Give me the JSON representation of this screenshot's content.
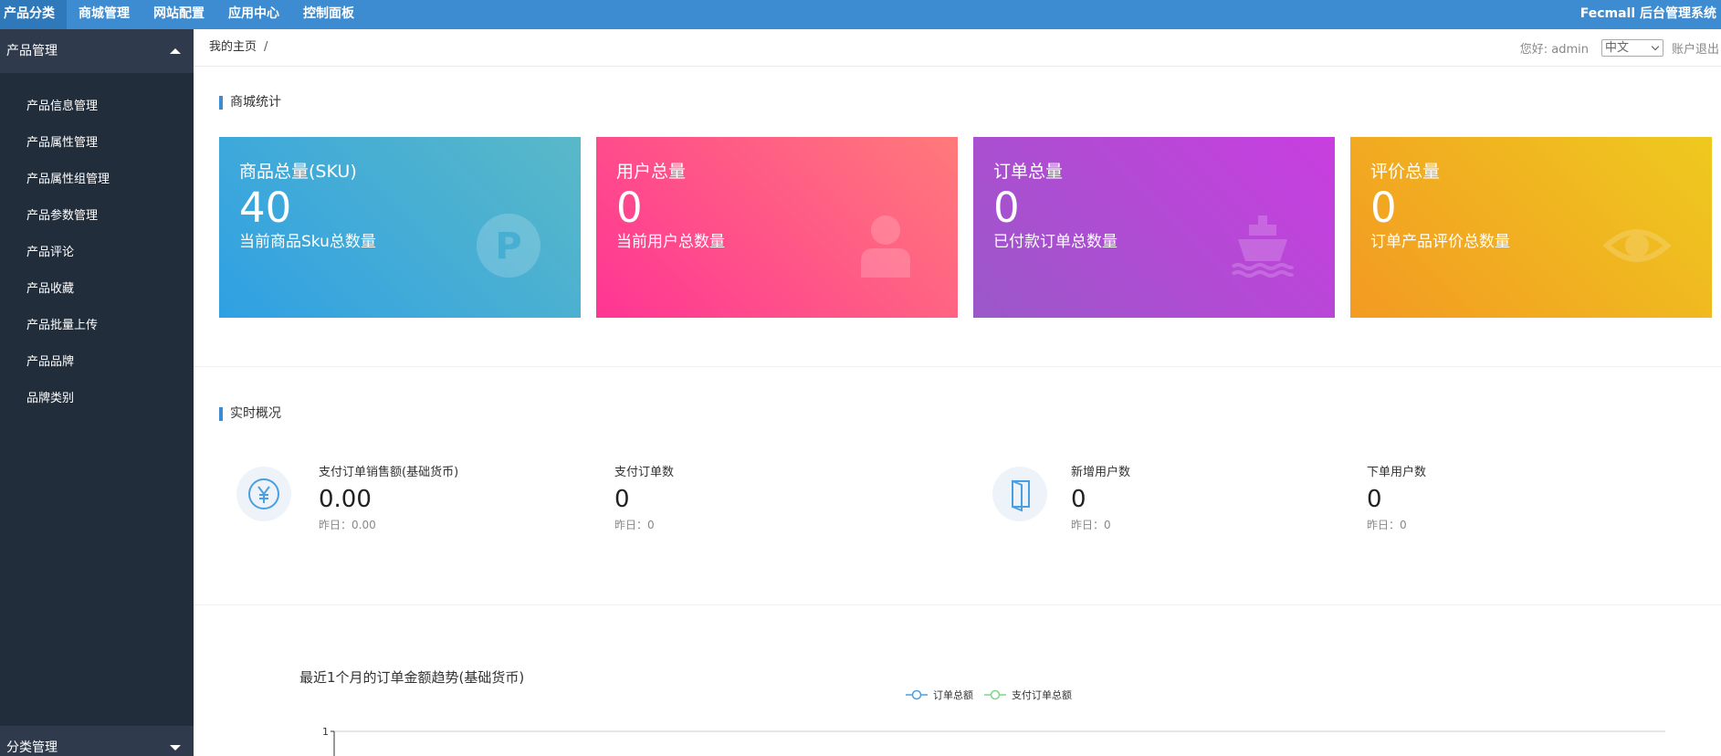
{
  "topnav": {
    "items": [
      {
        "label": "产品分类"
      },
      {
        "label": "商城管理"
      },
      {
        "label": "网站配置"
      },
      {
        "label": "应用中心"
      },
      {
        "label": "控制面板"
      }
    ],
    "brand": "Fecmall 后台管理系统"
  },
  "sidebar": {
    "group1": "产品管理",
    "items": [
      {
        "label": "产品信息管理"
      },
      {
        "label": "产品属性管理"
      },
      {
        "label": "产品属性组管理"
      },
      {
        "label": "产品参数管理"
      },
      {
        "label": "产品评论"
      },
      {
        "label": "产品收藏"
      },
      {
        "label": "产品批量上传"
      },
      {
        "label": "产品品牌"
      },
      {
        "label": "品牌类别"
      }
    ],
    "group2": "分类管理"
  },
  "header": {
    "breadcrumb": "我的主页",
    "breadcrumb_sep": "/",
    "greeting": "您好: admin",
    "language": "中文",
    "logout": "账户退出"
  },
  "stats_section": {
    "title": "商城统计",
    "cards": [
      {
        "title": "商品总量(SKU)",
        "value": "40",
        "desc": "当前商品Sku总数量",
        "icon": "parking-icon"
      },
      {
        "title": "用户总量",
        "value": "0",
        "desc": "当前用户总数量",
        "icon": "user-icon"
      },
      {
        "title": "订单总量",
        "value": "0",
        "desc": "已付款订单总数量",
        "icon": "ship-icon"
      },
      {
        "title": "评价总量",
        "value": "0",
        "desc": "订单产品评价总数量",
        "icon": "eye-icon"
      }
    ]
  },
  "realtime": {
    "title": "实时概况",
    "items": [
      {
        "label": "支付订单销售额(基础货币)",
        "value": "0.00",
        "yesterday": "昨日：0.00"
      },
      {
        "label": "支付订单数",
        "value": "0",
        "yesterday": "昨日：0"
      },
      {
        "label": "新增用户数",
        "value": "0",
        "yesterday": "昨日：0"
      },
      {
        "label": "下单用户数",
        "value": "0",
        "yesterday": "昨日：0"
      }
    ]
  },
  "chart_data": {
    "type": "line",
    "title": "最近1个月的订单金额趋势(基础货币)",
    "series": [
      {
        "name": "订单总额",
        "color": "#4a9fe0"
      },
      {
        "name": "支付订单总额",
        "color": "#7ed58b"
      }
    ],
    "y_ticks": [
      "1"
    ]
  }
}
